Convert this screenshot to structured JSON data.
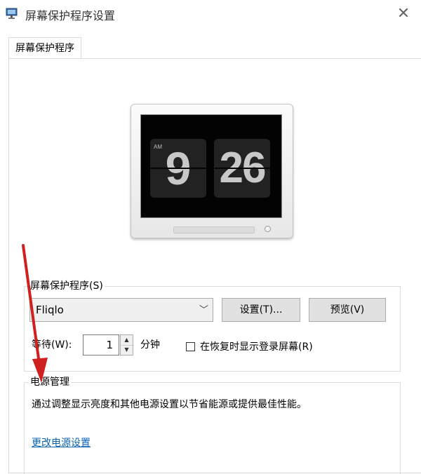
{
  "window": {
    "title": "屏幕保护程序设置",
    "close_symbol": "✕"
  },
  "tabs": [
    {
      "label": "屏幕保护程序"
    }
  ],
  "preview": {
    "ampm": "AM",
    "hour": "9",
    "minute": "26"
  },
  "screensaver": {
    "group_label": "屏幕保护程序(S)",
    "selected": "Fliqlo",
    "settings_button": "设置(T)...",
    "preview_button": "预览(V)",
    "wait_label": "等待(W):",
    "wait_value": "1",
    "minutes_label": "分钟",
    "resume_checkbox_label": "在恢复时显示登录屏幕(R)",
    "resume_checked": false
  },
  "power": {
    "group_label": "电源管理",
    "description": "通过调整显示亮度和其他电源设置以节省能源或提供最佳性能。",
    "link": "更改电源设置"
  },
  "annotation": {
    "arrow_color": "#d01f1f"
  }
}
